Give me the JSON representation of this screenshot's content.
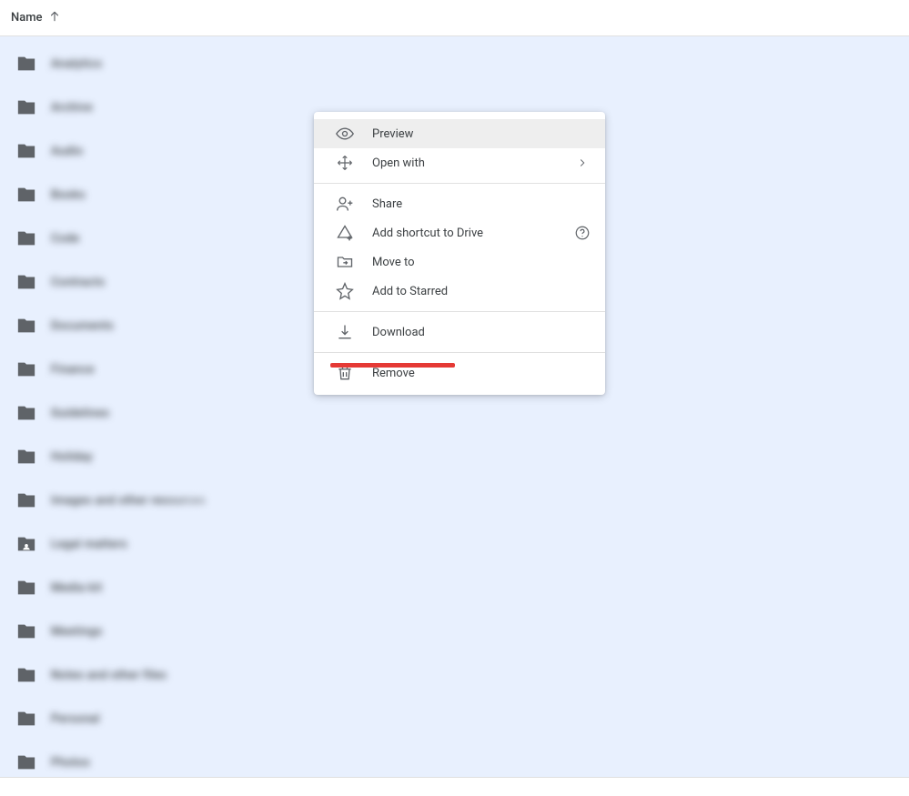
{
  "header": {
    "column_label": "Name",
    "sort_direction": "asc"
  },
  "files": [
    {
      "name": "Analytics",
      "shared": false
    },
    {
      "name": "Archive",
      "shared": false
    },
    {
      "name": "Audio",
      "shared": false
    },
    {
      "name": "Books",
      "shared": false
    },
    {
      "name": "Code",
      "shared": false
    },
    {
      "name": "Contracts",
      "shared": false
    },
    {
      "name": "Documents",
      "shared": false
    },
    {
      "name": "Finance",
      "shared": false
    },
    {
      "name": "Guidelines",
      "shared": false
    },
    {
      "name": "Holiday",
      "shared": false
    },
    {
      "name": "Images and other resources",
      "shared": false
    },
    {
      "name": "Legal matters",
      "shared": true
    },
    {
      "name": "Media kit",
      "shared": false
    },
    {
      "name": "Meetings",
      "shared": false
    },
    {
      "name": "Notes and other files",
      "shared": false
    },
    {
      "name": "Personal",
      "shared": false
    },
    {
      "name": "Photos",
      "shared": false
    }
  ],
  "context_menu": {
    "preview": "Preview",
    "open_with": "Open with",
    "share": "Share",
    "add_shortcut": "Add shortcut to Drive",
    "move_to": "Move to",
    "add_starred": "Add to Starred",
    "download": "Download",
    "remove": "Remove"
  }
}
